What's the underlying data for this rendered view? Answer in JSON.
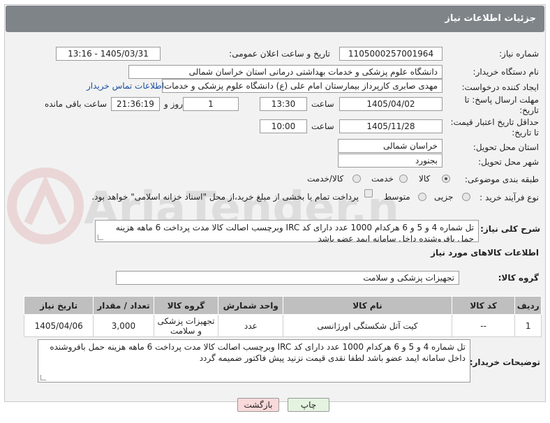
{
  "header": {
    "title": "جزئیات اطلاعات نیاز"
  },
  "fields": {
    "need_number_label": "شماره نیاز:",
    "need_number": "1105000257001964",
    "announce_label": "تاریخ و ساعت اعلان عمومی:",
    "announce_value": "1405/03/31 - 13:16",
    "buyer_org_label": "نام دستگاه خریدار:",
    "buyer_org": "دانشگاه علوم پزشکی و خدمات بهداشتی درمانی استان خراسان شمالی",
    "requester_label": "ایجاد کننده درخواست:",
    "requester": "مهدی صابری کارپرداز بیمارستان امام علی (ع) دانشگاه علوم پزشکی و خدمات د",
    "contact_link": "اطلاعات تماس خریدار",
    "deadline_label_1": "مهلت ارسال پاسخ: تا",
    "deadline_label_2": "تاریخ:",
    "deadline_date": "1405/04/02",
    "time_label": "ساعت",
    "deadline_time": "13:30",
    "days": "1",
    "days_label": "روز و",
    "remaining_time": "21:36:19",
    "remaining_label": "ساعت باقی مانده",
    "min_price_label_1": "حداقل تاریخ اعتبار قیمت:",
    "min_price_label_2": "تا تاریخ:",
    "validity_date": "1405/11/28",
    "validity_time": "10:00",
    "province_label": "استان محل تحویل:",
    "province": "خراسان شمالی",
    "city_label": "شهر محل تحویل:",
    "city": "بجنورد",
    "category_label": "طبقه بندی موضوعی:",
    "category_options": [
      "کالا",
      "خدمت",
      "کالا/خدمت"
    ],
    "process_label": "نوع فرآیند خرید :",
    "process_options": [
      "جزیی",
      "متوسط"
    ],
    "payment_note": "پرداخت تمام یا بخشی از مبلغ خرید،از محل \"اسناد خزانه اسلامی\" خواهد بود."
  },
  "description": {
    "label": "شرح کلی نیاز:",
    "text": "تل شماره 4 و 5 و 6 هرکدام 1000 عدد دارای کد IRC وبرچسب اصالت کالا مدت پرداخت 6 ماهه هزینه حمل بافروشنده داخل سامانه ایمد عضو باشد"
  },
  "goods_info": {
    "title": "اطلاعات کالاهای مورد نیاز",
    "group_label": "گروه کالا:",
    "group_value": "تجهیزات پزشکی و سلامت"
  },
  "table": {
    "headers": [
      "ردیف",
      "کد کالا",
      "نام کالا",
      "واحد شمارش",
      "گروه کالا",
      "تعداد / مقدار",
      "تاریخ نیاز"
    ],
    "rows": [
      [
        "1",
        "--",
        "کیت آتل شکستگی اورژانسی",
        "عدد",
        "تجهیزات پزشکی و سلامت",
        "3,000",
        "1405/04/06"
      ]
    ]
  },
  "buyer_notes": {
    "label": "توضیحات خریدار:",
    "text": "تل شماره 4 و 5 و 6 هرکدام 1000 عدد دارای کد IRC وبرچسب اصالت کالا مدت پرداخت 6 ماهه هزینه حمل بافروشنده داخل سامانه ایمد عضو باشد لطفا نقدی قیمت نزنید  پیش فاکتور ضمیمه گردد"
  },
  "buttons": {
    "print": "چاپ",
    "back": "بازگشت"
  },
  "watermark": "AriaTender.net",
  "colors": {
    "header_bg": "#7f8489",
    "link": "#1a4fa3",
    "back_btn": "#f9d9d9",
    "print_btn": "#e3f3e0"
  }
}
